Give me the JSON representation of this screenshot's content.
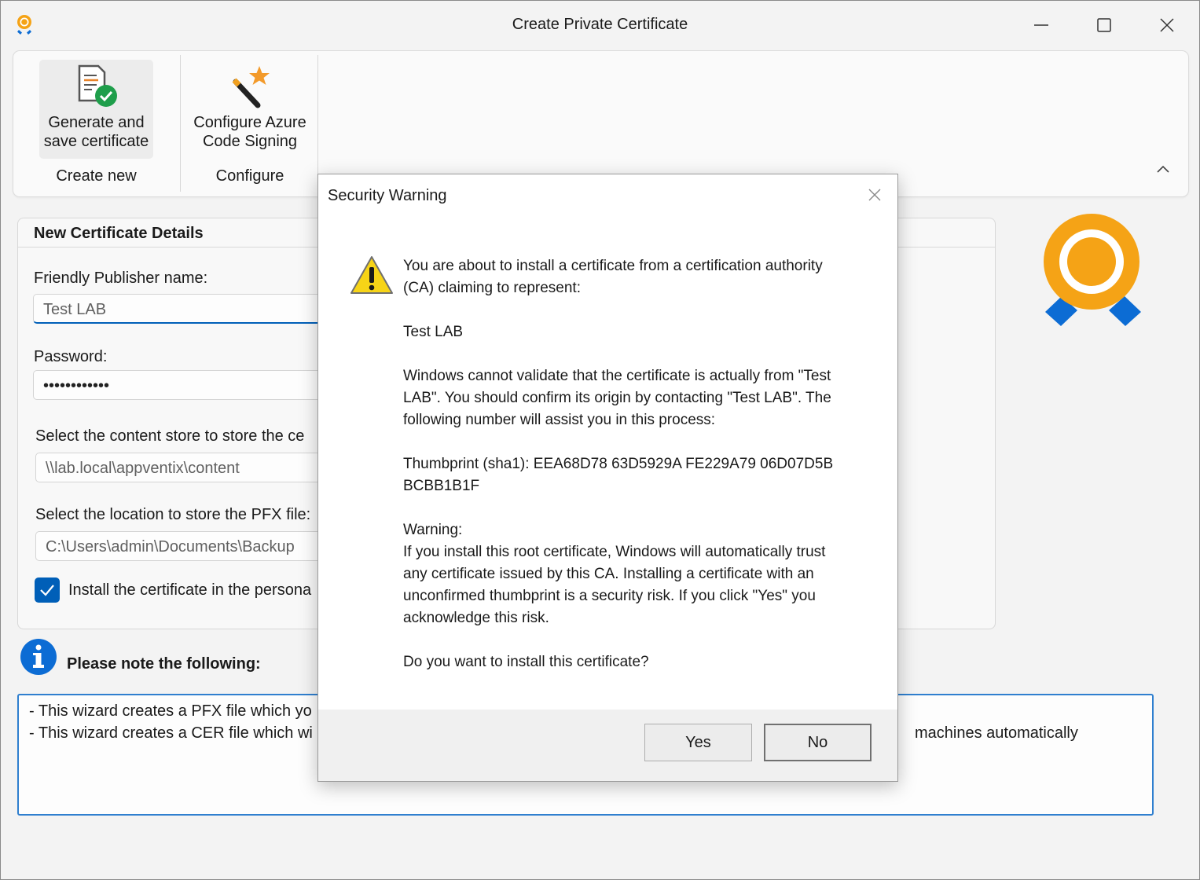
{
  "window": {
    "title": "Create Private Certificate"
  },
  "ribbon": {
    "generate_label_1": "Generate and",
    "generate_label_2": "save certificate",
    "configure_label_1": "Configure Azure",
    "configure_label_2": "Code Signing",
    "group_create": "Create new",
    "group_configure": "Configure"
  },
  "details": {
    "title": "New Certificate Details",
    "publisher_label": "Friendly Publisher name:",
    "publisher_value": "Test LAB",
    "password_label": "Password:",
    "password_value": "••••••••••••",
    "content_store_label": "Select the content store to store the ce",
    "content_store_value": "\\\\lab.local\\appventix\\content",
    "pfx_location_label": "Select the location to store the PFX file:",
    "pfx_location_value": "C:\\Users\\admin\\Documents\\Backup",
    "install_checkbox_label": "Install the certificate in the persona",
    "install_checked": true
  },
  "notes": {
    "title": "Please note the following:",
    "line1": "- This wizard creates a PFX file which yo",
    "line2": "- This wizard creates a CER file which wi",
    "line2_tail": "machines automatically"
  },
  "dialog": {
    "title": "Security Warning",
    "para1_l1": "You are about to install a certificate from a certification authority",
    "para1_l2": "(CA) claiming to represent:",
    "subject": "Test LAB",
    "para2_l1": "Windows cannot validate that the certificate is actually from \"Test",
    "para2_l2": "LAB\". You should confirm its origin by contacting \"Test LAB\". The",
    "para2_l3": "following number will assist you in this process:",
    "thumb_l1": "Thumbprint (sha1): EEA68D78 63D5929A FE229A79 06D07D5B",
    "thumb_l2": "BCBB1B1F",
    "warning_head": "Warning:",
    "warn_l1": "If you install this root certificate, Windows will automatically trust",
    "warn_l2": "any certificate issued by this CA. Installing a certificate with an",
    "warn_l3": "unconfirmed thumbprint is a security risk. If you click \"Yes\" you",
    "warn_l4": "acknowledge this risk.",
    "question": "Do you want to install this certificate?",
    "yes": "Yes",
    "no": "No"
  },
  "colors": {
    "accent": "#005fb8",
    "award": "#f5a316",
    "award_ribbon": "#0c6cd4"
  }
}
